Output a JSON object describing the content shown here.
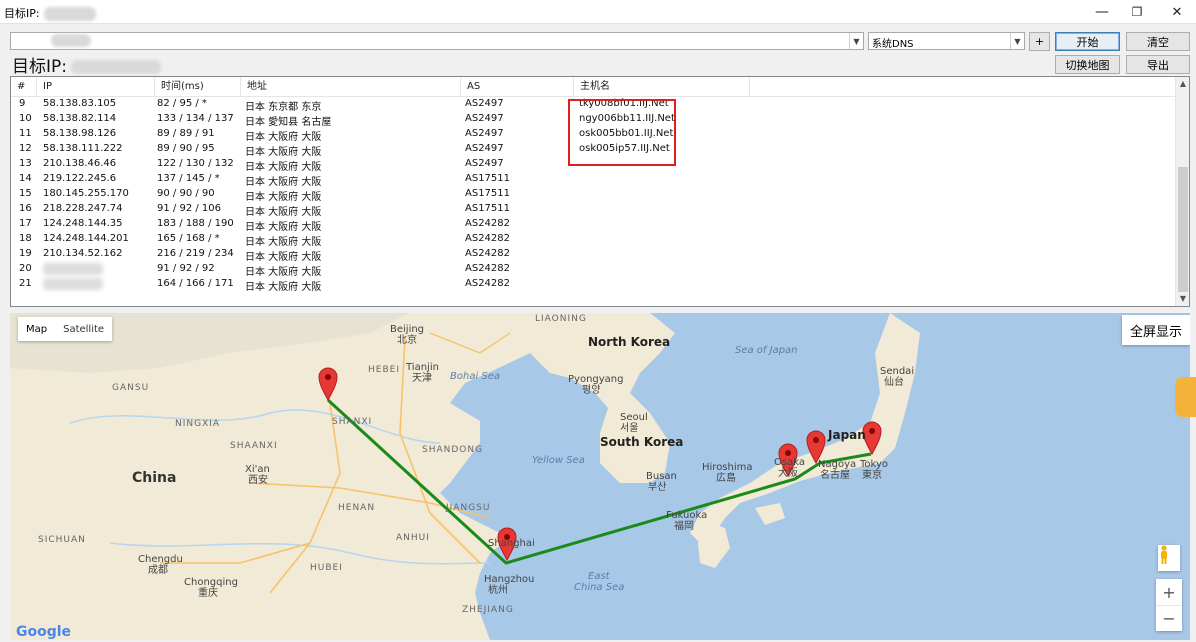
{
  "window": {
    "title": "目标IP:",
    "minimize": "—",
    "restore": "❐",
    "close": "✕"
  },
  "toolbar": {
    "target_combo_value": "",
    "dns_combo_value": "系统DNS",
    "plus_label": "+",
    "start_label": "开始",
    "clear_label": "清空",
    "switch_map_label": "切换地图",
    "export_label": "导出",
    "target_label": "目标IP:"
  },
  "table": {
    "headers": [
      "#",
      "IP",
      "时间(ms)",
      "地址",
      "AS",
      "主机名"
    ],
    "rows": [
      {
        "n": "9",
        "ip": "58.138.83.105",
        "time": "82 / 95 / *",
        "addr": "日本 东京都 东京",
        "as": "AS2497",
        "host": "tky008bf01.IIJ.Net"
      },
      {
        "n": "10",
        "ip": "58.138.82.114",
        "time": "133 / 134 / 137",
        "addr": "日本 愛知县 名古屋",
        "as": "AS2497",
        "host": "ngy006bb11.IIJ.Net"
      },
      {
        "n": "11",
        "ip": "58.138.98.126",
        "time": "89 / 89 / 91",
        "addr": "日本 大阪府 大阪",
        "as": "AS2497",
        "host": "osk005bb01.IIJ.Net"
      },
      {
        "n": "12",
        "ip": "58.138.111.222",
        "time": "89 / 90 / 95",
        "addr": "日本 大阪府 大阪",
        "as": "AS2497",
        "host": "osk005ip57.IIJ.Net"
      },
      {
        "n": "13",
        "ip": "210.138.46.46",
        "time": "122 / 130 / 132",
        "addr": "日本 大阪府 大阪",
        "as": "AS2497",
        "host": ""
      },
      {
        "n": "14",
        "ip": "219.122.245.6",
        "time": "137 / 145 / *",
        "addr": "日本 大阪府 大阪",
        "as": "AS17511",
        "host": ""
      },
      {
        "n": "15",
        "ip": "180.145.255.170",
        "time": "90 / 90 / 90",
        "addr": "日本 大阪府 大阪",
        "as": "AS17511",
        "host": ""
      },
      {
        "n": "16",
        "ip": "218.228.247.74",
        "time": "91 / 92 / 106",
        "addr": "日本 大阪府 大阪",
        "as": "AS17511",
        "host": ""
      },
      {
        "n": "17",
        "ip": "124.248.144.35",
        "time": "183 / 188 / 190",
        "addr": "日本 大阪府 大阪",
        "as": "AS24282",
        "host": ""
      },
      {
        "n": "18",
        "ip": "124.248.144.201",
        "time": "165 / 168 / *",
        "addr": "日本 大阪府 大阪",
        "as": "AS24282",
        "host": ""
      },
      {
        "n": "19",
        "ip": "210.134.52.162",
        "time": "216 / 219 / 234",
        "addr": "日本 大阪府 大阪",
        "as": "AS24282",
        "host": ""
      },
      {
        "n": "20",
        "ip": "",
        "time": "91 / 92 / 92",
        "addr": "日本 大阪府 大阪",
        "as": "AS24282",
        "host": ""
      },
      {
        "n": "21",
        "ip": "",
        "time": "164 / 166 / 171",
        "addr": "日本 大阪府 大阪",
        "as": "AS24282",
        "host": ""
      }
    ]
  },
  "map": {
    "map_label": "Map",
    "satellite_label": "Satellite",
    "fullscreen_label": "全屏显示",
    "zoom_in": "+",
    "zoom_out": "−",
    "google": "Google",
    "labels": {
      "beijing": "Beijing",
      "beijing_cn": "北京",
      "tianjin": "Tianjin",
      "tianjin_cn": "天津",
      "hebei": "HEBEI",
      "shanxi": "SHANXI",
      "shandong": "SHANDONG",
      "henan": "HENAN",
      "jiangsu": "JIANGSU",
      "anhui": "ANHUI",
      "hubei": "HUBEI",
      "zhejiang": "ZHEJIANG",
      "shaanxi": "SHAANXI",
      "ningxia": "NINGXIA",
      "gansu": "GANSU",
      "sichuan": "SICHUAN",
      "liaoning": "LIAONING",
      "china": "China",
      "xian": "Xi'an",
      "xian_cn": "西安",
      "chengdu": "Chengdu",
      "chengdu_cn": "成都",
      "chongqing": "Chongqing",
      "chongqing_cn": "重庆",
      "shanghai": "Shanghai",
      "shanghai_cn": "上海",
      "hangzhou": "Hangzhou",
      "hangzhou_cn": "杭州",
      "north_korea": "North Korea",
      "pyongyang": "Pyongyang",
      "pyongyang_kr": "평양",
      "south_korea": "South Korea",
      "seoul": "Seoul",
      "seoul_kr": "서울",
      "busan": "Busan",
      "busan_kr": "부산",
      "japan": "Japan",
      "sendai": "Sendai",
      "sendai_cn": "仙台",
      "tokyo": "Tokyo",
      "tokyo_cn": "東京",
      "nagoya": "Nagoya",
      "nagoya_cn": "名古屋",
      "osaka": "Osaka",
      "osaka_cn": "大阪",
      "hiroshima": "Hiroshima",
      "hiroshima_cn": "広島",
      "fukuoka": "Fukuoka",
      "fukuoka_cn": "福岡",
      "sea_of_japan": "Sea of Japan",
      "bohai_sea": "Bohai Sea",
      "yellow_sea": "Yellow Sea",
      "east_china_sea_1": "East",
      "east_china_sea_2": "China Sea"
    },
    "route_color": "#1a8a1a",
    "pin_color": "#e53935"
  }
}
